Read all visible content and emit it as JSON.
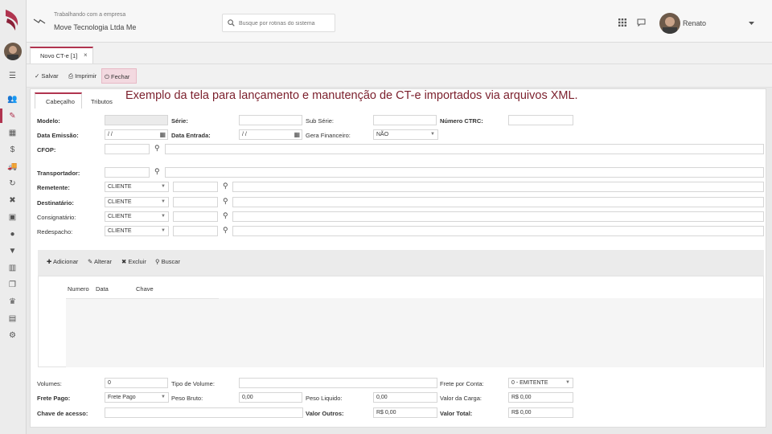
{
  "header": {
    "company_caption": "Trabalhando com a empresa",
    "company_name": "Move Tecnologia Ltda Me",
    "search_placeholder": "Busque por rotinas do sistema",
    "user_name": "Renato"
  },
  "doc_tab": {
    "label": "Novo CT-e [1]",
    "close": "×"
  },
  "toolbar": {
    "save": "Salvar",
    "print": "Imprimir",
    "close": "Fechar"
  },
  "caption": "Exemplo da tela para lançamento e manutenção de CT-e importados via arquivos XML.",
  "inner_tabs": [
    "Cabeçalho",
    "Tributos"
  ],
  "form": {
    "modelo": "Modelo:",
    "serie": "Série:",
    "sub_serie": "Sub Série:",
    "numero_ctrc": "Número CTRC:",
    "data_emissao": "Data Emissão:",
    "data_emissao_value": " / /",
    "data_entrada": "Data Entrada:",
    "data_entrada_value": " / /",
    "gera_financeiro": "Gera Financeiro:",
    "gera_financeiro_value": "NÃO",
    "cfop": "CFOP:",
    "transportador": "Transportador:",
    "remetente": "Remetente:",
    "destinatario": "Destinatário:",
    "consignatario": "Consignatário:",
    "redespacho": "Redespacho:",
    "party_type": "CLIENTE"
  },
  "grid": {
    "add": "Adicionar",
    "edit": "Alterar",
    "delete": "Excluir",
    "search": "Buscar",
    "columns": [
      "Numero",
      "Data",
      "Chave"
    ]
  },
  "footer": {
    "volumes": "Volumes:",
    "volumes_value": "0",
    "tipo_volume": "Tipo de Volume:",
    "frete_por_conta": "Frete por Conta:",
    "frete_por_conta_value": "0 - EMITENTE",
    "frete_pago": "Frete Pago:",
    "frete_pago_value": "Frete Pago",
    "peso_bruto": "Peso Bruto:",
    "peso_bruto_value": "0,00",
    "peso_liquido": "Peso Liquido:",
    "peso_liquido_value": "0,00",
    "valor_carga": "Valor da Carga:",
    "valor_carga_value": "R$ 0,00",
    "chave_acesso": "Chave de acesso:",
    "valor_outros": "Valor Outros:",
    "valor_outros_value": "R$ 0,00",
    "valor_total": "Valor Total:",
    "valor_total_value": "R$ 0,00"
  }
}
